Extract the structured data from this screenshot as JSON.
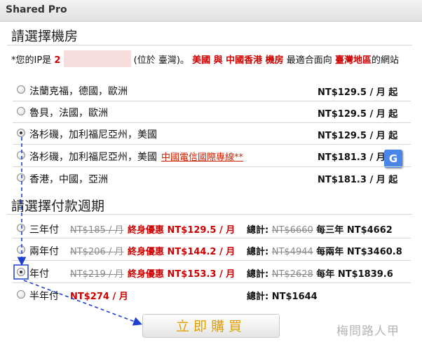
{
  "window": {
    "title": "Shared Pro"
  },
  "datacenter": {
    "heading": "請選擇機房",
    "ip_prefix": "*您的IP是",
    "ip_value": "2",
    "ip_location": "(位於 臺灣)。",
    "recommend_regions": "美國 與 中國香港 機房",
    "recommend_middle": "最適合面向",
    "recommend_target": "臺灣地區",
    "recommend_suffix": "的網站",
    "options": [
      {
        "location": "法蘭克福，德國，歐洲",
        "price": "NT$129.5 / 月 起",
        "link": ""
      },
      {
        "location": "魯貝，法國，歐洲",
        "price": "NT$129.5 / 月 起",
        "link": ""
      },
      {
        "location": "洛杉磯，加利福尼亞州，美國",
        "price": "NT$129.5 / 月 起",
        "link": ""
      },
      {
        "location": "洛杉磯，加利福尼亞州，美國",
        "price": "NT$181.3 / 月",
        "link": "中國電信國際專線**"
      },
      {
        "location": "香港，中國，亞洲",
        "price": "NT$181.3 / 月 起",
        "link": ""
      }
    ]
  },
  "billing": {
    "heading": "請選擇付款週期",
    "total_label": "總計:",
    "options": [
      {
        "term": "三年付",
        "original": "NT$185 / 月",
        "promo": "終身優惠 NT$129.5 / 月",
        "total_original": "NT$6660",
        "total_final": "每三年 NT$4662"
      },
      {
        "term": "兩年付",
        "original": "NT$206 / 月",
        "promo": "終身優惠 NT$144.2 / 月",
        "total_original": "NT$4944",
        "total_final": "每兩年 NT$3460.8"
      },
      {
        "term": "年付",
        "original": "NT$219 / 月",
        "promo": "終身優惠 NT$153.3 / 月",
        "total_original": "NT$2628",
        "total_final": "每年 NT$1839.6"
      },
      {
        "term": "半年付",
        "price": "NT$274 / 月",
        "total_final": "NT$1644"
      }
    ]
  },
  "buy_button": {
    "label": "立即購買"
  },
  "translate_icon": {
    "name": "google-translate-icon",
    "glyph": "G"
  },
  "watermark": {
    "text": "梅問路人甲"
  },
  "colors": {
    "accent_red": "#cc0000",
    "button_text": "#e2a000",
    "annotation": "#1f3fd0"
  }
}
